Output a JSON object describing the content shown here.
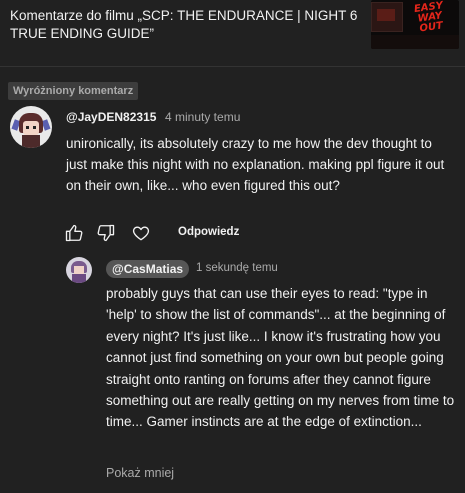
{
  "header": {
    "video_title": "Komentarze do filmu „SCP: THE ENDURANCE | NIGHT 6 TRUE ENDING GUIDE”",
    "thumbnail_text": "EASY WAY OUT"
  },
  "pinned_badge": "Wyróżniony komentarz",
  "comment": {
    "author": "@JayDEN82315",
    "time": "4 minuty temu",
    "text": "unironically, its absolutely crazy to me how the dev thought to just make this night with no explanation. making ppl figure it out on their own, like... who even figured this out?",
    "actions": {
      "like_icon": "thumbs-up-icon",
      "dislike_icon": "thumbs-down-icon",
      "heart_icon": "heart-icon",
      "reply_label": "Odpowiedz"
    }
  },
  "reply": {
    "author": "@CasMatias",
    "time": "1 sekundę temu",
    "text": "probably guys that can use their eyes to read: \"type in 'help' to show the list of commands\"... at the beginning of every night? It's just like... I know it's frustrating how you cannot just find something on your own but people going straight onto ranting on forums after they cannot figure something out are really getting on my nerves from time to time... Gamer instincts are at the edge of extinction...",
    "show_less": "Pokaż mniej"
  }
}
